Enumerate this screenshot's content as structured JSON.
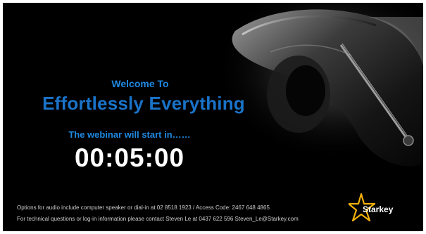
{
  "slide": {
    "welcome": "Welcome To",
    "title": "Effortlessly Everything",
    "subtitle": "The webinar will start in……",
    "countdown": "00:05:00",
    "footer_line_1": "Options for audio include computer speaker or dial-in at 02 8518 1923 /  Access Code: 2467 648 4865",
    "footer_line_2": "For technical questions or log-in information please contact Steven Le at 0437 622 596   Steven_Le@Starkey.com"
  },
  "logo": {
    "brand_name": "Starkey",
    "star_color": "#f2b10a"
  },
  "colors": {
    "background": "#000000",
    "accent_blue": "#1a73c8",
    "light_blue": "#1e88e0",
    "countdown_text": "#ffffff"
  }
}
